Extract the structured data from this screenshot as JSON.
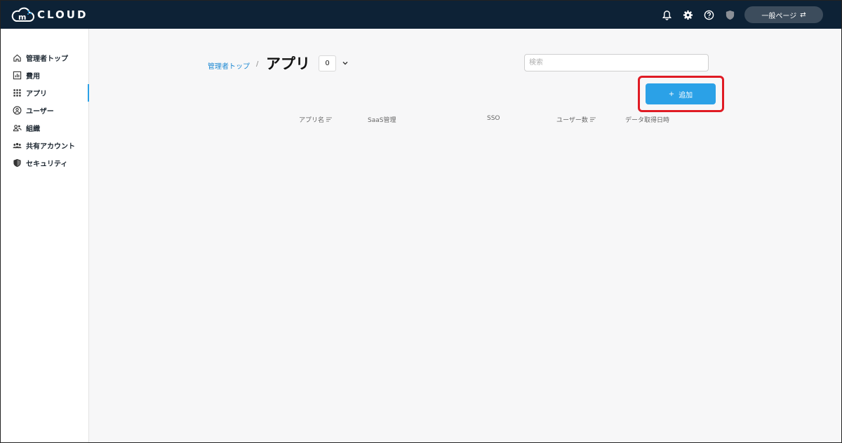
{
  "brand": {
    "logo_text": "CLOUD",
    "accent": "#2ba1e7",
    "topbar_color": "#0d2236",
    "highlight_color": "#e01b24"
  },
  "topbar": {
    "icons": [
      "bell-icon",
      "gear-icon",
      "help-icon",
      "shield-icon"
    ],
    "switch_label": "一般ページ",
    "switch_icon": "swap-arrows-icon"
  },
  "sidebar": {
    "items": [
      {
        "label": "管理者トップ",
        "icon": "home-icon"
      },
      {
        "label": "費用",
        "icon": "chart-icon"
      },
      {
        "label": "アプリ",
        "icon": "grid-icon",
        "active": true
      },
      {
        "label": "ユーザー",
        "icon": "user-icon"
      },
      {
        "label": "組織",
        "icon": "group-icon"
      },
      {
        "label": "共有アカウント",
        "icon": "shared-account-icon"
      },
      {
        "label": "セキュリティ",
        "icon": "shield-icon"
      }
    ]
  },
  "main": {
    "breadcrumb": "管理者トップ",
    "separator": "/",
    "title": "アプリ",
    "count": "0",
    "search_placeholder": "検索",
    "add_button": {
      "icon": "+",
      "label": "追加"
    },
    "columns": [
      {
        "label": "アプリ名",
        "sortable": true
      },
      {
        "label": "SaaS管理",
        "sortable": false
      },
      {
        "label": "SSO",
        "sortable": false
      },
      {
        "label": "ユーザー数",
        "sortable": true
      },
      {
        "label": "データ取得日時",
        "sortable": false
      }
    ]
  }
}
